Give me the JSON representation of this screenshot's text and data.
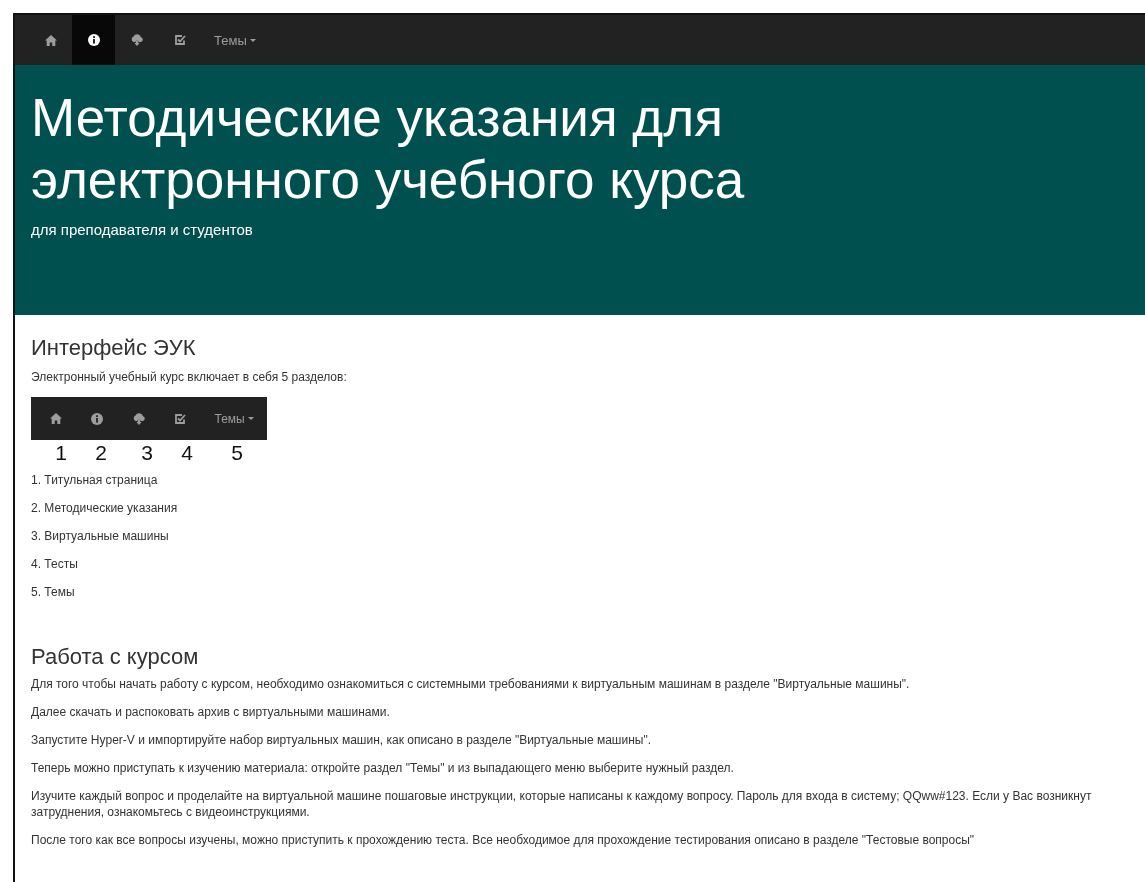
{
  "navbar": {
    "items": [
      {
        "kind": "icon",
        "selected": false
      },
      {
        "kind": "icon",
        "selected": true
      },
      {
        "kind": "icon",
        "selected": false
      },
      {
        "kind": "icon",
        "selected": false
      },
      {
        "kind": "dropdown",
        "label": "Темы",
        "selected": false
      }
    ]
  },
  "hero": {
    "title_lines": [
      "Методические указания для",
      "электронного учебного курса"
    ],
    "subtitle": "для преподавателя и студентов"
  },
  "interface_section": {
    "heading": "Интерфейс ЭУК",
    "intro": "Электронный учебный курс включает в себя 5 разделов:",
    "figure": {
      "menu_label": "Темы",
      "numbers": [
        "1",
        "2",
        "3",
        "4",
        "5"
      ]
    },
    "items": [
      "1. Титульная страница",
      "2. Методические указания",
      "3. Виртуальные машины",
      "4. Тесты",
      "5. Темы"
    ]
  },
  "work_section": {
    "heading": "Работа с курсом",
    "paragraphs": [
      "Для того чтобы начать работу с курсом, необходимо ознакомиться с системными требованиями к виртуальным машинам в разделе \"Виртуальные машины\".",
      "Далее скачать и распоковать архив с виртуальными машинами.",
      "Запустите Hyper-V и импортируйте набор виртуальных машин, как описано в разделе \"Виртуальные машины\".",
      "Теперь можно приступать к изучению материала: откройте раздел \"Темы\" и из выпадающего меню выберите нужный раздел.",
      "Изучите каждый вопрос и проделайте на виртуальной машине пошаговые инструкции, которые написаны к каждому вопросу. Пароль для входа в систему; QQww#123. Если у Вас возникнут затруднения, ознакомьтесь с видеоинструкциями.",
      "После того как все вопросы изучены, можно приступить к прохождению теста. Все необходимое для прохождение тестирования описано в разделе \"Тестовые вопросы\""
    ]
  }
}
